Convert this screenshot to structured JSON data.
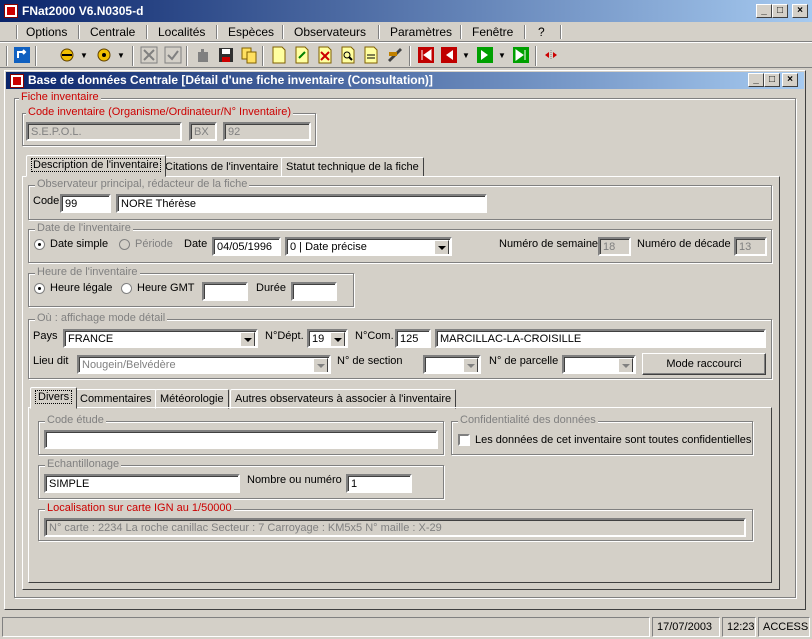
{
  "app": {
    "title": "FNat2000 V6.N0305-d"
  },
  "menu": [
    "Options",
    "Centrale",
    "Localités",
    "Espèces",
    "Observateurs",
    "Paramètres",
    "Fenêtre",
    "?"
  ],
  "child": {
    "title": "Base de données Centrale [Détail d'une fiche inventaire (Consultation)]"
  },
  "fiche": {
    "legend": "Fiche inventaire",
    "code_legend": "Code inventaire (Organisme/Ordinateur/N° Inventaire)",
    "code_org": "S.E.P.O.L.",
    "code_ordi": "BX",
    "code_num": "92"
  },
  "tabs": [
    "Description de l'inventaire",
    "Citations de l'inventaire",
    "Statut technique de la fiche"
  ],
  "observateur": {
    "legend": "Observateur principal, rédacteur de la fiche",
    "code_label": "Code",
    "code": "99",
    "name": "NORE Thérèse"
  },
  "date": {
    "legend": "Date de l'inventaire",
    "simple": "Date simple",
    "periode": "Période",
    "date_label": "Date",
    "date": "04/05/1996",
    "precision": "0 | Date précise",
    "semaine_label": "Numéro de semaine",
    "semaine": "18",
    "decade_label": "Numéro de décade",
    "decade": "13"
  },
  "heure": {
    "legend": "Heure de l'inventaire",
    "legale": "Heure légale",
    "gmt": "Heure GMT",
    "duree_label": "Durée",
    "heure": "",
    "duree": ""
  },
  "ou": {
    "legend": "Où : affichage mode détail",
    "pays_label": "Pays",
    "pays": "FRANCE",
    "dept_label": "N°Dépt.",
    "dept": "19",
    "com_label": "N°Com.",
    "com": "125",
    "commune": "MARCILLAC-LA-CROISILLE",
    "lieudit_label": "Lieu dit",
    "lieudit": "Nougein/Belvédère",
    "section_label": "N° de section",
    "parcelle_label": "N° de parcelle",
    "mode_button": "Mode raccourci"
  },
  "subtabs": [
    "Divers",
    "Commentaires",
    "Météorologie",
    "Autres observateurs à associer à l'inventaire"
  ],
  "divers": {
    "code_etude_legend": "Code étude",
    "code_etude": "",
    "confid_legend": "Confidentialité des données",
    "confid_label": "Les données de cet inventaire sont toutes confidentielles",
    "echant_legend": "Echantillonage",
    "echant": "SIMPLE",
    "nombre_label": "Nombre ou numéro",
    "nombre": "1",
    "ign_legend": "Localisation sur carte IGN au 1/50000",
    "ign": "N° carte : 2234 La roche canillac  Secteur : 7  Carroyage : KM5x5  N° maille : X-29"
  },
  "statusbar": {
    "date": "17/07/2003",
    "time": "12:23",
    "mode": "ACCESS"
  }
}
